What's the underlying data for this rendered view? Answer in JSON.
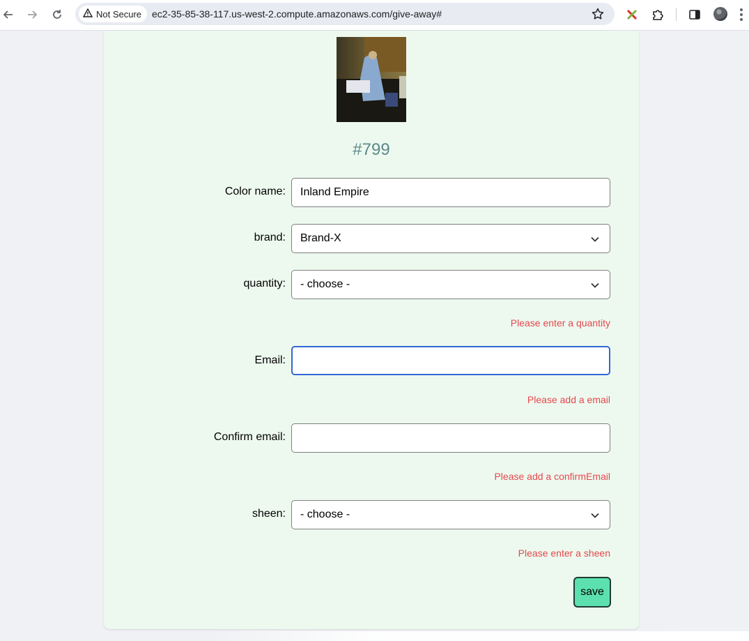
{
  "browser": {
    "security_label": "Not Secure",
    "url": "ec2-35-85-38-117.us-west-2.compute.amazonaws.com/give-away#",
    "icons": [
      "back-arrow-icon",
      "forward-arrow-icon",
      "reload-icon",
      "warning-triangle-icon",
      "bookmark-star-icon",
      "extension-x-icon",
      "puzzle-extensions-icon",
      "side-panel-icon",
      "profile-avatar-icon",
      "menu-dots-icon"
    ]
  },
  "form": {
    "item_number": "#799",
    "fields": {
      "color_name": {
        "label": "Color name:",
        "value": "Inland Empire"
      },
      "brand": {
        "label": "brand:",
        "value": "Brand-X"
      },
      "quantity": {
        "label": "quantity:",
        "value": "- choose -",
        "error": "Please enter a quantity"
      },
      "email": {
        "label": "Email:",
        "value": "",
        "error": "Please add a email"
      },
      "confirm_email": {
        "label": "Confirm email:",
        "value": "",
        "error": "Please add a confirmEmail"
      },
      "sheen": {
        "label": "sheen:",
        "value": "- choose -",
        "error": "Please enter a sheen"
      }
    },
    "save_label": "save"
  },
  "colors": {
    "card_bg": "#edf9ef",
    "item_number": "#5b8a8a",
    "error": "#e5484d",
    "save_bg": "#5ce0b0",
    "focus": "#3367d6"
  }
}
